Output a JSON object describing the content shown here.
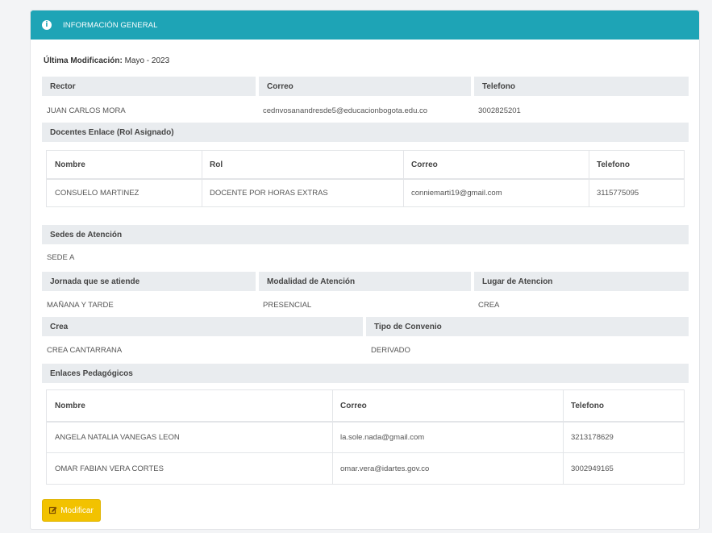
{
  "header": {
    "title": "INFORMACIÓN GENERAL",
    "icon": "info-icon"
  },
  "last_mod": {
    "label": "Última Modificación:",
    "value": "Mayo - 2023"
  },
  "rector_table": {
    "headers": [
      "Rector",
      "Correo",
      "Telefono"
    ],
    "values": [
      "JUAN CARLOS MORA",
      "cednvosanandresde5@educacionbogota.edu.co",
      "3002825201"
    ]
  },
  "docentes": {
    "title": "Docentes Enlace (Rol Asignado)",
    "headers": [
      "Nombre",
      "Rol",
      "Correo",
      "Telefono"
    ],
    "rows": [
      [
        "CONSUELO MARTINEZ",
        "DOCENTE POR HORAS EXTRAS",
        "conniemarti19@gmail.com",
        "3115775095"
      ]
    ]
  },
  "sedes": {
    "title": "Sedes de Atención",
    "value": "SEDE A"
  },
  "jornada_table": {
    "headers": [
      "Jornada que se atiende",
      "Modalidad de Atención",
      "Lugar de Atencion"
    ],
    "values": [
      "MAÑANA Y TARDE",
      "PRESENCIAL",
      "CREA"
    ]
  },
  "crea_table": {
    "headers": [
      "Crea",
      "Tipo de Convenio"
    ],
    "values": [
      "CREA CANTARRANA",
      "DERIVADO"
    ]
  },
  "enlaces": {
    "title": "Enlaces Pedagógicos",
    "headers": [
      "Nombre",
      "Correo",
      "Telefono"
    ],
    "rows": [
      [
        "ANGELA NATALIA VANEGAS LEON",
        "la.sole.nada@gmail.com",
        "3213178629"
      ],
      [
        "OMAR FABIAN VERA CORTES",
        "omar.vera@idartes.gov.co",
        "3002949165"
      ]
    ]
  },
  "buttons": {
    "modify": "Modificar",
    "modify_icon": "edit-icon"
  },
  "colors": {
    "header": "#1ea4b6",
    "button": "#f2c200",
    "label_bg": "#e9ecef"
  }
}
